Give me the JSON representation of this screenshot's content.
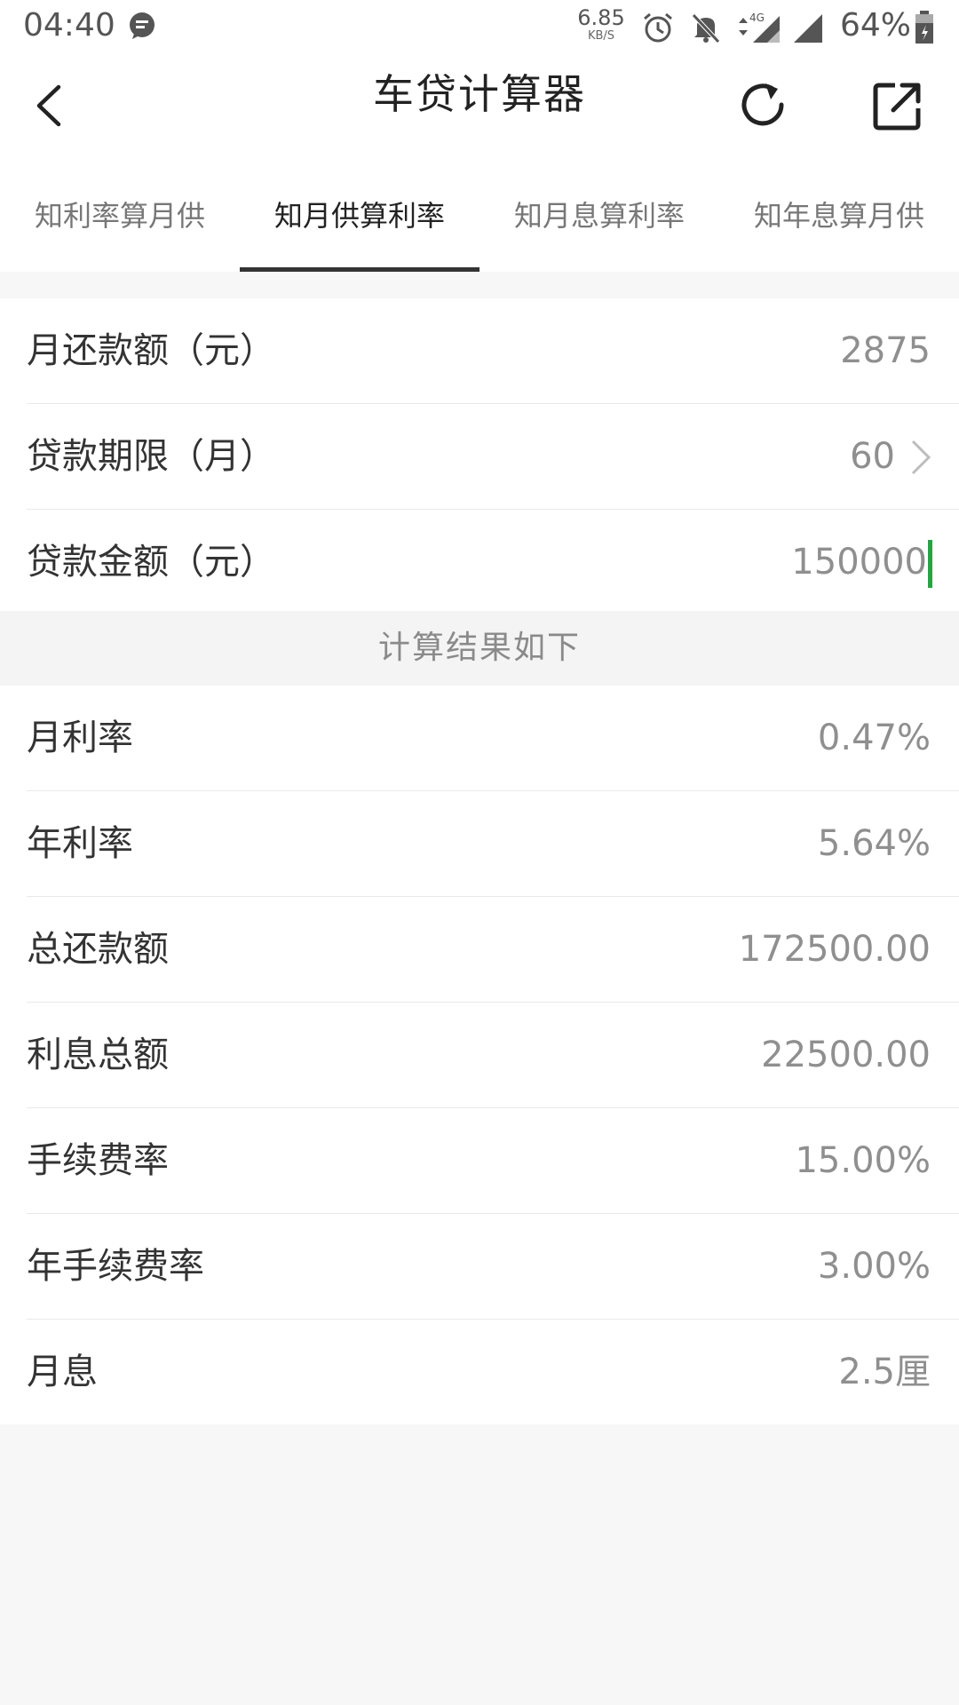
{
  "status_bar": {
    "time": "04:40",
    "net_speed": "6.85",
    "net_speed_unit": "KB/S",
    "network_type": "4G",
    "battery": "64%",
    "icons": [
      "message-icon",
      "alarm-icon",
      "mute-icon",
      "data-arrows-icon",
      "signal-icon",
      "battery-icon"
    ]
  },
  "header": {
    "title": "车贷计算器",
    "back_icon": "back-arrow-icon",
    "refresh_icon": "refresh-icon",
    "share_icon": "share-icon"
  },
  "tabs": [
    {
      "label": "知利率算月供",
      "active": false
    },
    {
      "label": "知月供算利率",
      "active": true
    },
    {
      "label": "知月息算利率",
      "active": false
    },
    {
      "label": "知年息算月供",
      "active": false
    }
  ],
  "inputs": {
    "monthly_payment": {
      "label": "月还款额（元）",
      "value": "2875"
    },
    "loan_term": {
      "label": "贷款期限（月）",
      "value": "60"
    },
    "loan_amount": {
      "label": "贷款金额（元）",
      "value": "150000"
    }
  },
  "result_header": "计算结果如下",
  "results": [
    {
      "label": "月利率",
      "value": "0.47%"
    },
    {
      "label": "年利率",
      "value": "5.64%"
    },
    {
      "label": "总还款额",
      "value": "172500.00"
    },
    {
      "label": "利息总额",
      "value": "22500.00"
    },
    {
      "label": "手续费率",
      "value": "15.00%"
    },
    {
      "label": "年手续费率",
      "value": "3.00%"
    },
    {
      "label": "月息",
      "value": "2.5厘"
    }
  ],
  "colors": {
    "accent_cursor": "#27a344",
    "tab_indicator": "#333333",
    "value_text": "#8f8f8f"
  }
}
